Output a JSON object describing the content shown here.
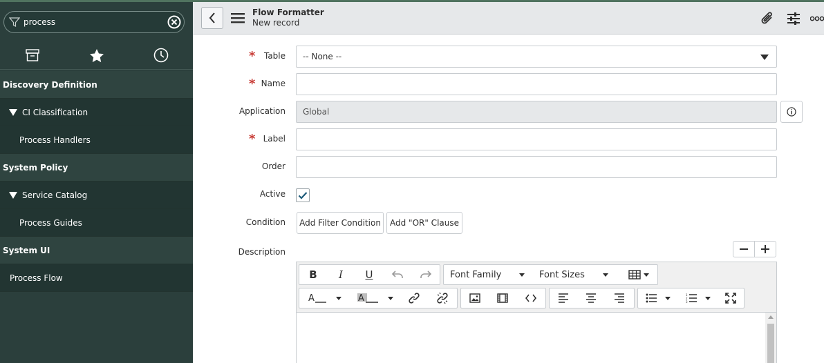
{
  "sidebar": {
    "filter": {
      "value": "process",
      "placeholder": "Filter navigator"
    },
    "tabs": [
      {
        "name": "all-applications",
        "icon": "archive-icon"
      },
      {
        "name": "favorites",
        "icon": "star-icon"
      },
      {
        "name": "history",
        "icon": "clock-icon"
      }
    ],
    "items": [
      {
        "label": "Discovery Definition"
      },
      {
        "label": "CI Classification"
      },
      {
        "label": "Process Handlers"
      },
      {
        "label": "System Policy"
      },
      {
        "label": "Service Catalog"
      },
      {
        "label": "Process Guides"
      },
      {
        "label": "System UI"
      },
      {
        "label": "Process Flow"
      }
    ]
  },
  "header": {
    "title": "Flow Formatter",
    "subtitle": "New record"
  },
  "form": {
    "table": {
      "label": "Table",
      "value": "-- None --"
    },
    "name": {
      "label": "Name",
      "value": ""
    },
    "application": {
      "label": "Application",
      "value": "Global"
    },
    "label": {
      "label": "Label",
      "value": ""
    },
    "order": {
      "label": "Order",
      "value": ""
    },
    "active": {
      "label": "Active",
      "checked": true
    },
    "condition": {
      "label": "Condition",
      "add_filter_label": "Add Filter Condition",
      "add_or_label": "Add \"OR\" Clause"
    },
    "description": {
      "label": "Description",
      "zoom_out": "−",
      "zoom_in": "+",
      "font_family": "Font Family",
      "font_sizes": "Font Sizes",
      "bold": "B",
      "italic": "I",
      "underline": "U"
    }
  },
  "colors": {
    "sidebar_bg": "#2b3f3c",
    "header_bg": "#e6e8ea",
    "required": "#c83c36",
    "checkbox": "#278efc"
  }
}
